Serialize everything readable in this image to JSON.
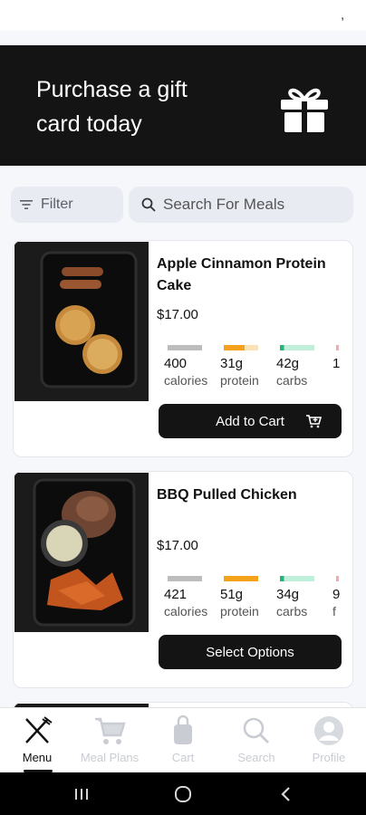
{
  "banner": {
    "title": "Purchase a gift card today"
  },
  "filter": {
    "label": "Filter"
  },
  "search": {
    "placeholder": "Search For Meals"
  },
  "meals": [
    {
      "name": "Apple Cinnamon Protein Cake",
      "price": "$17.00",
      "macros": [
        {
          "value": "400",
          "unit": "calories",
          "color": "#bdbdbd"
        },
        {
          "value": "31g",
          "unit": "protein",
          "color": "#f5a21b"
        },
        {
          "value": "42g",
          "unit": "carbs",
          "color": "#9ee6c9"
        },
        {
          "value": "1",
          "unit": "",
          "color": "#f7a9a9"
        }
      ],
      "button": "Add to Cart"
    },
    {
      "name": "BBQ Pulled Chicken",
      "price": "$17.00",
      "macros": [
        {
          "value": "421",
          "unit": "calories",
          "color": "#bdbdbd"
        },
        {
          "value": "51g",
          "unit": "protein",
          "color": "#f5a21b"
        },
        {
          "value": "34g",
          "unit": "carbs",
          "color": "#9ee6c9"
        },
        {
          "value": "9",
          "unit": "f",
          "color": "#f7a9a9"
        }
      ],
      "button": "Select Options"
    }
  ],
  "nav": [
    {
      "label": "Menu",
      "icon": "fork-knife-icon",
      "active": true
    },
    {
      "label": "Meal Plans",
      "icon": "cart-icon",
      "active": false
    },
    {
      "label": "Cart",
      "icon": "bag-icon",
      "active": false
    },
    {
      "label": "Search",
      "icon": "search-icon",
      "active": false
    },
    {
      "label": "Profile",
      "icon": "profile-icon",
      "active": false
    }
  ],
  "colors": {
    "dark": "#141414",
    "inactive": "#c9ccd2",
    "field_bg": "#e8ebf2"
  }
}
